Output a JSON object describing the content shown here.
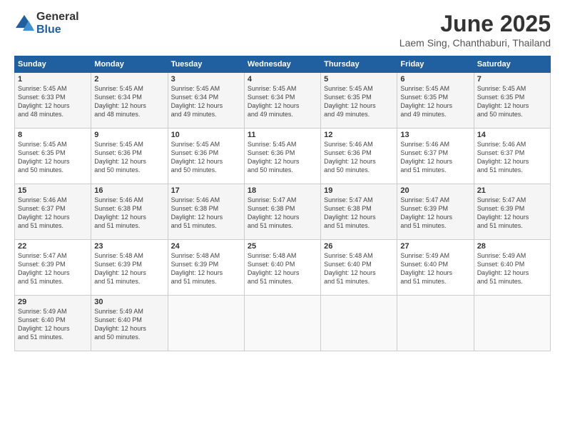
{
  "logo": {
    "general": "General",
    "blue": "Blue"
  },
  "title": "June 2025",
  "subtitle": "Laem Sing, Chanthaburi, Thailand",
  "headers": [
    "Sunday",
    "Monday",
    "Tuesday",
    "Wednesday",
    "Thursday",
    "Friday",
    "Saturday"
  ],
  "weeks": [
    [
      {
        "day": "1",
        "info": "Sunrise: 5:45 AM\nSunset: 6:33 PM\nDaylight: 12 hours\nand 48 minutes."
      },
      {
        "day": "2",
        "info": "Sunrise: 5:45 AM\nSunset: 6:34 PM\nDaylight: 12 hours\nand 48 minutes."
      },
      {
        "day": "3",
        "info": "Sunrise: 5:45 AM\nSunset: 6:34 PM\nDaylight: 12 hours\nand 49 minutes."
      },
      {
        "day": "4",
        "info": "Sunrise: 5:45 AM\nSunset: 6:34 PM\nDaylight: 12 hours\nand 49 minutes."
      },
      {
        "day": "5",
        "info": "Sunrise: 5:45 AM\nSunset: 6:35 PM\nDaylight: 12 hours\nand 49 minutes."
      },
      {
        "day": "6",
        "info": "Sunrise: 5:45 AM\nSunset: 6:35 PM\nDaylight: 12 hours\nand 49 minutes."
      },
      {
        "day": "7",
        "info": "Sunrise: 5:45 AM\nSunset: 6:35 PM\nDaylight: 12 hours\nand 50 minutes."
      }
    ],
    [
      {
        "day": "8",
        "info": "Sunrise: 5:45 AM\nSunset: 6:35 PM\nDaylight: 12 hours\nand 50 minutes."
      },
      {
        "day": "9",
        "info": "Sunrise: 5:45 AM\nSunset: 6:36 PM\nDaylight: 12 hours\nand 50 minutes."
      },
      {
        "day": "10",
        "info": "Sunrise: 5:45 AM\nSunset: 6:36 PM\nDaylight: 12 hours\nand 50 minutes."
      },
      {
        "day": "11",
        "info": "Sunrise: 5:45 AM\nSunset: 6:36 PM\nDaylight: 12 hours\nand 50 minutes."
      },
      {
        "day": "12",
        "info": "Sunrise: 5:46 AM\nSunset: 6:36 PM\nDaylight: 12 hours\nand 50 minutes."
      },
      {
        "day": "13",
        "info": "Sunrise: 5:46 AM\nSunset: 6:37 PM\nDaylight: 12 hours\nand 51 minutes."
      },
      {
        "day": "14",
        "info": "Sunrise: 5:46 AM\nSunset: 6:37 PM\nDaylight: 12 hours\nand 51 minutes."
      }
    ],
    [
      {
        "day": "15",
        "info": "Sunrise: 5:46 AM\nSunset: 6:37 PM\nDaylight: 12 hours\nand 51 minutes."
      },
      {
        "day": "16",
        "info": "Sunrise: 5:46 AM\nSunset: 6:38 PM\nDaylight: 12 hours\nand 51 minutes."
      },
      {
        "day": "17",
        "info": "Sunrise: 5:46 AM\nSunset: 6:38 PM\nDaylight: 12 hours\nand 51 minutes."
      },
      {
        "day": "18",
        "info": "Sunrise: 5:47 AM\nSunset: 6:38 PM\nDaylight: 12 hours\nand 51 minutes."
      },
      {
        "day": "19",
        "info": "Sunrise: 5:47 AM\nSunset: 6:38 PM\nDaylight: 12 hours\nand 51 minutes."
      },
      {
        "day": "20",
        "info": "Sunrise: 5:47 AM\nSunset: 6:39 PM\nDaylight: 12 hours\nand 51 minutes."
      },
      {
        "day": "21",
        "info": "Sunrise: 5:47 AM\nSunset: 6:39 PM\nDaylight: 12 hours\nand 51 minutes."
      }
    ],
    [
      {
        "day": "22",
        "info": "Sunrise: 5:47 AM\nSunset: 6:39 PM\nDaylight: 12 hours\nand 51 minutes."
      },
      {
        "day": "23",
        "info": "Sunrise: 5:48 AM\nSunset: 6:39 PM\nDaylight: 12 hours\nand 51 minutes."
      },
      {
        "day": "24",
        "info": "Sunrise: 5:48 AM\nSunset: 6:39 PM\nDaylight: 12 hours\nand 51 minutes."
      },
      {
        "day": "25",
        "info": "Sunrise: 5:48 AM\nSunset: 6:40 PM\nDaylight: 12 hours\nand 51 minutes."
      },
      {
        "day": "26",
        "info": "Sunrise: 5:48 AM\nSunset: 6:40 PM\nDaylight: 12 hours\nand 51 minutes."
      },
      {
        "day": "27",
        "info": "Sunrise: 5:49 AM\nSunset: 6:40 PM\nDaylight: 12 hours\nand 51 minutes."
      },
      {
        "day": "28",
        "info": "Sunrise: 5:49 AM\nSunset: 6:40 PM\nDaylight: 12 hours\nand 51 minutes."
      }
    ],
    [
      {
        "day": "29",
        "info": "Sunrise: 5:49 AM\nSunset: 6:40 PM\nDaylight: 12 hours\nand 51 minutes."
      },
      {
        "day": "30",
        "info": "Sunrise: 5:49 AM\nSunset: 6:40 PM\nDaylight: 12 hours\nand 50 minutes."
      },
      {
        "day": "",
        "info": ""
      },
      {
        "day": "",
        "info": ""
      },
      {
        "day": "",
        "info": ""
      },
      {
        "day": "",
        "info": ""
      },
      {
        "day": "",
        "info": ""
      }
    ]
  ]
}
